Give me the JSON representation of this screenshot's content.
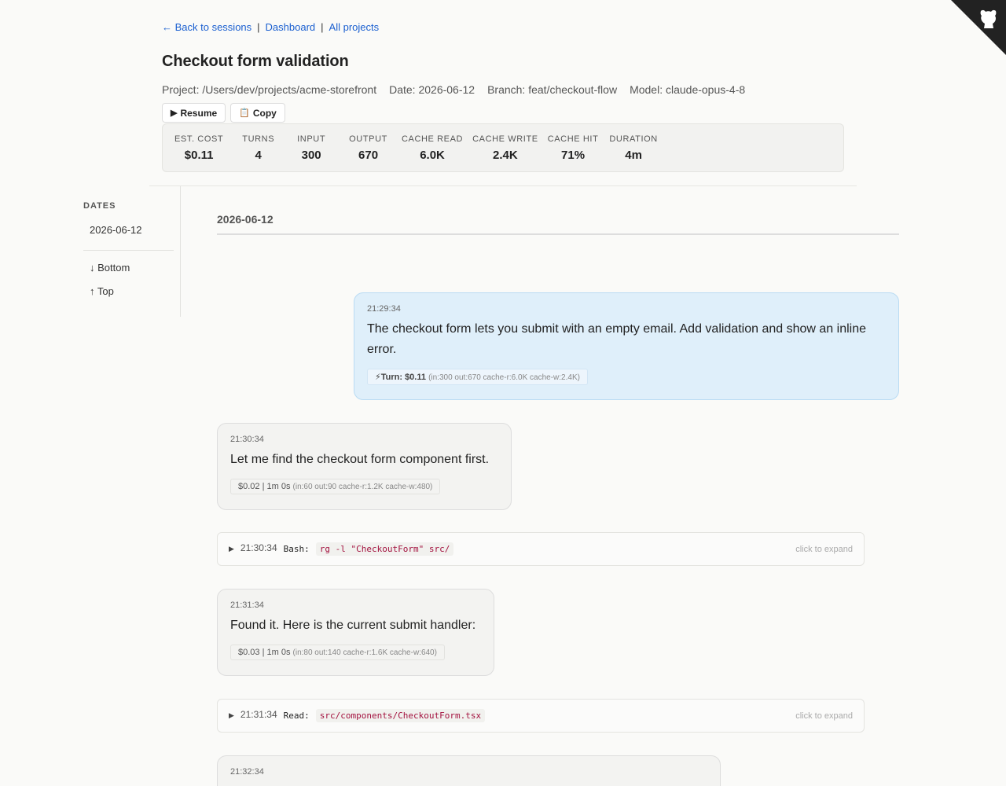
{
  "nav": {
    "back": "← Back to sessions",
    "dashboard": "Dashboard",
    "all_projects": "All projects",
    "sep": "|"
  },
  "page_title": "Checkout form validation",
  "meta": {
    "project": "Project: /Users/dev/projects/acme-storefront",
    "date": "Date: 2026-06-12",
    "branch": "Branch: feat/checkout-flow",
    "model": "Model: claude-opus-4-8"
  },
  "buttons": {
    "resume": "Resume",
    "copy": "Copy"
  },
  "stats": [
    {
      "label": "EST. COST",
      "value": "$0.11"
    },
    {
      "label": "TURNS",
      "value": "4"
    },
    {
      "label": "INPUT",
      "value": "300"
    },
    {
      "label": "OUTPUT",
      "value": "670"
    },
    {
      "label": "CACHE READ",
      "value": "6.0K"
    },
    {
      "label": "CACHE WRITE",
      "value": "2.4K"
    },
    {
      "label": "CACHE HIT",
      "value": "71%"
    },
    {
      "label": "DURATION",
      "value": "4m"
    }
  ],
  "sidebar": {
    "section_label": "DATES",
    "dates": [
      "2026-06-12"
    ],
    "bottom": "↓ Bottom",
    "top": "↑ Top"
  },
  "date_heading": "2026-06-12",
  "messages": [
    {
      "role": "user",
      "time": "21:29:34",
      "text": "The checkout form lets you submit with an empty email. Add validation and show an inline error.",
      "cost_main": "⚡Turn: $0.11",
      "cost_detail": "(in:300 out:670 cache-r:6.0K cache-w:2.4K)"
    },
    {
      "role": "assistant",
      "time": "21:30:34",
      "text": "Let me find the checkout form component first.",
      "cost_main": "$0.02 | 1m 0s",
      "cost_detail": "(in:60 out:90 cache-r:1.2K cache-w:480)"
    },
    {
      "role": "assistant",
      "time": "21:31:34",
      "text": "Found it. Here is the current submit handler:",
      "cost_main": "$0.03 | 1m 0s",
      "cost_detail": "(in:80 out:140 cache-r:1.6K cache-w:640)"
    },
    {
      "role": "assistant",
      "time": "21:32:34",
      "text": "",
      "cost_main": "",
      "cost_detail": ""
    }
  ],
  "tools": [
    {
      "time": "21:30:34",
      "name": "Bash:",
      "command": "rg -l \"CheckoutForm\" src/",
      "hint": "click to expand"
    },
    {
      "time": "21:31:34",
      "name": "Read:",
      "command": "src/components/CheckoutForm.tsx",
      "hint": "click to expand"
    }
  ],
  "icons": {
    "corner": "github-octocat-icon",
    "resume": "play-icon",
    "copy": "clipboard-icon",
    "expand": "triangle-right-icon"
  },
  "colors": {
    "link": "#1a5fd0",
    "user_bubble": "#dfeffa",
    "assistant_bubble": "#f3f3f1",
    "tool_command": "#a3123f"
  }
}
